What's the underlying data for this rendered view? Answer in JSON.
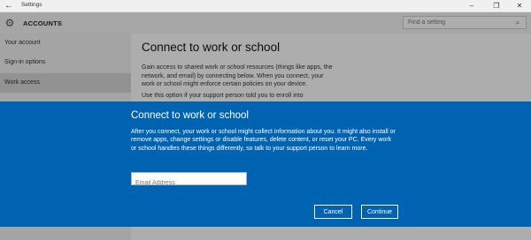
{
  "window": {
    "title": "Settings",
    "controls": {
      "minimize": "–",
      "maximize": "❐",
      "close": "✕"
    },
    "back_glyph": "←"
  },
  "header": {
    "title": "ACCOUNTS",
    "search_placeholder": "Find a setting",
    "icons": {
      "gear": "gear-icon",
      "search": "search-icon"
    }
  },
  "sidebar": {
    "items": [
      {
        "label": "Your account"
      },
      {
        "label": "Sign-in options"
      },
      {
        "label": "Work access"
      }
    ],
    "selected": "Work access"
  },
  "main": {
    "title": "Connect to work or school",
    "paragraph1": "Gain access to shared work or school resources (things like apps, the network, and email) by connecting below. When you connect, your work or school might enforce certain policies on your device.",
    "paragraph2": "Use this option if your support person told you to enroll into"
  },
  "dialog": {
    "title": "Connect to work or school",
    "body": "After you connect, your work or school might collect information about you. It might also install or remove apps, change settings or disable features, delete content, or reset your PC. Every work or school handles these things differently, so talk to your support person to learn more.",
    "email_placeholder": "Email Address",
    "cancel_label": "Cancel",
    "continue_label": "Continue"
  },
  "colors": {
    "dialog_background": "#0063b1",
    "selected_nav": "#d7d7d7",
    "overlay": "rgba(0,0,0,0.32)"
  }
}
